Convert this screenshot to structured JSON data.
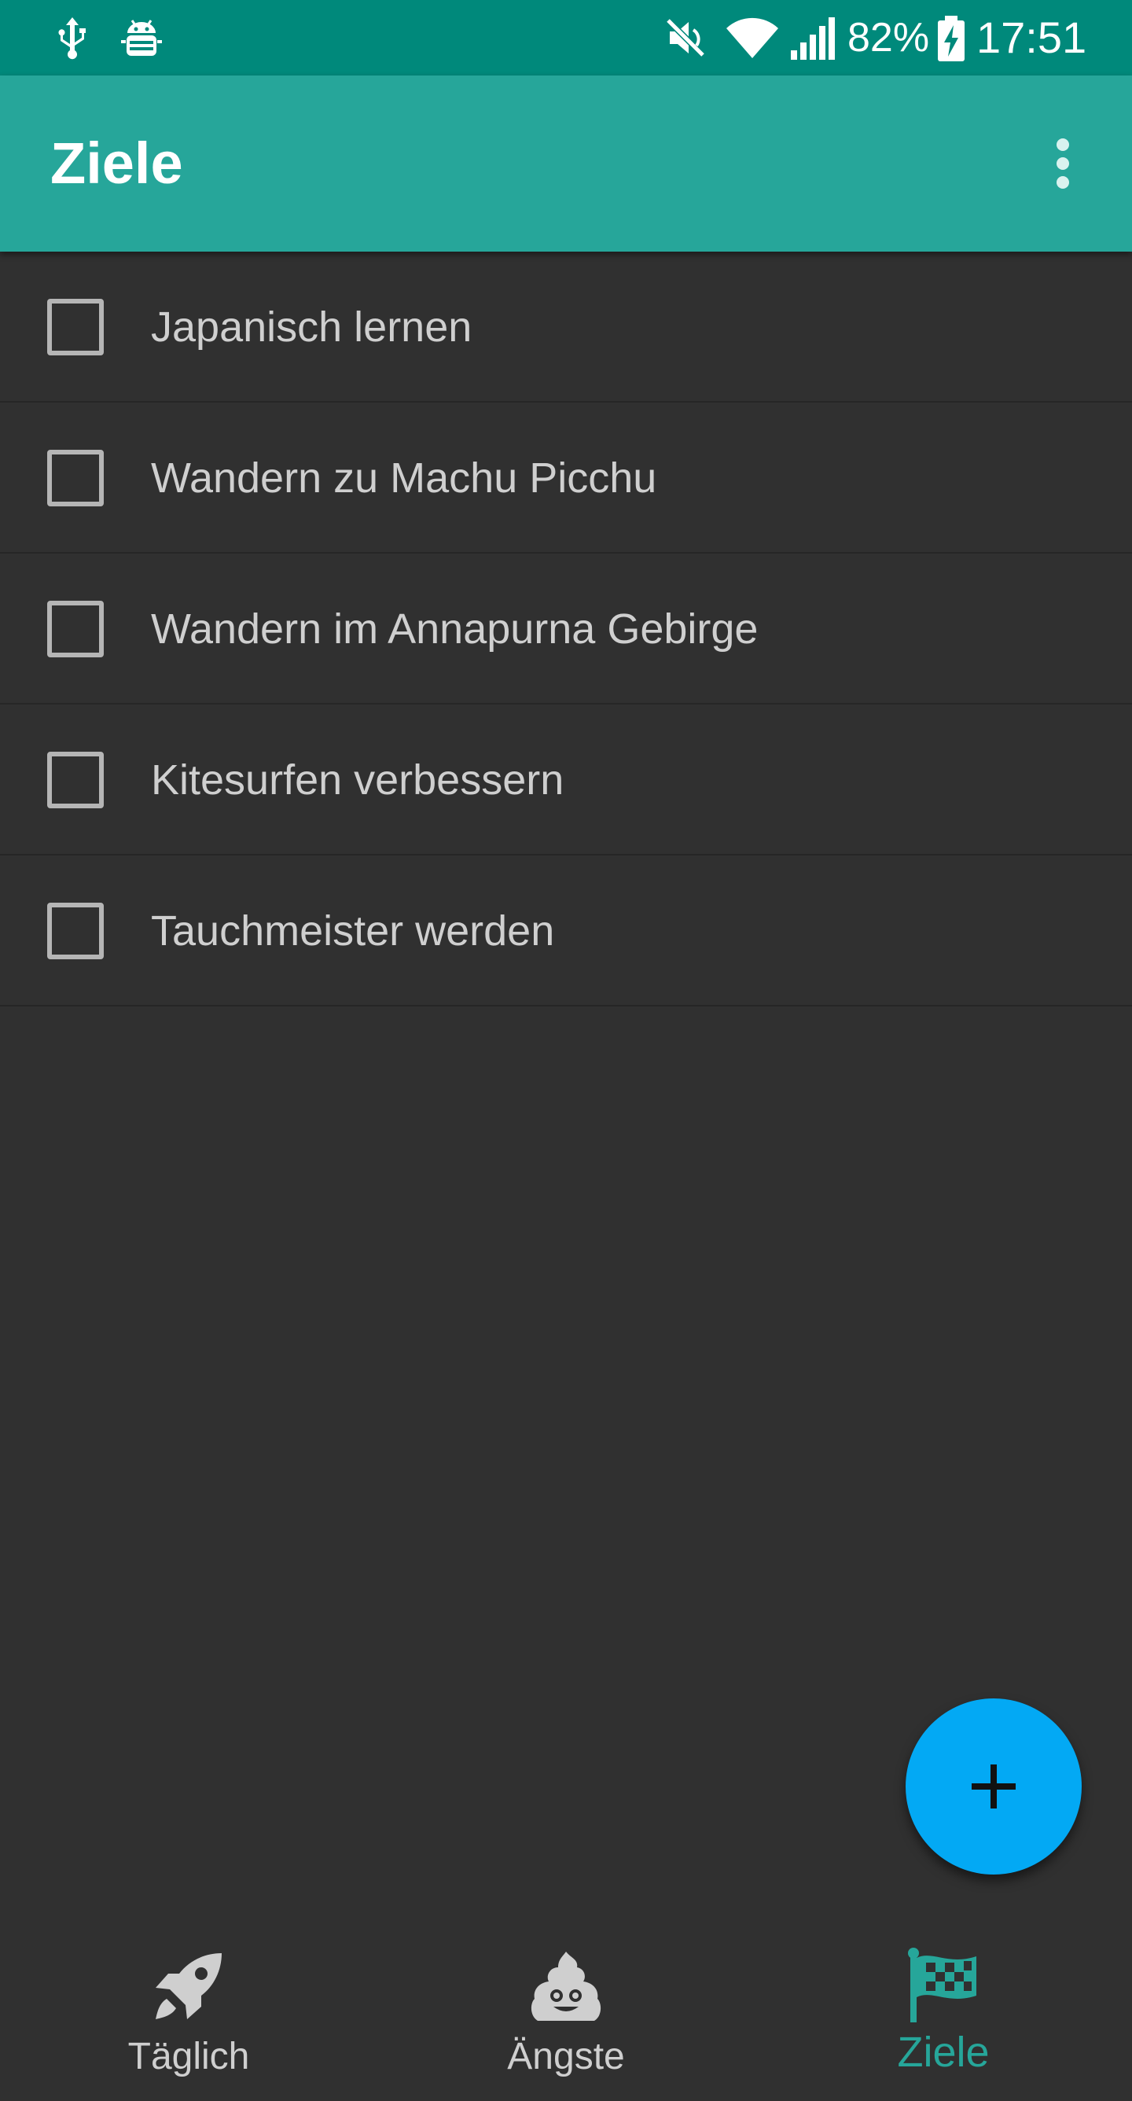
{
  "status_bar": {
    "battery_percent": "82%",
    "time": "17:51",
    "icons": [
      "usb-icon",
      "android-debug-icon",
      "mute-icon",
      "wifi-icon",
      "signal-icon",
      "battery-charging-icon"
    ]
  },
  "app_bar": {
    "title": "Ziele",
    "overflow_icon": "more-vert-icon"
  },
  "goals": [
    {
      "label": "Japanisch lernen",
      "checked": false
    },
    {
      "label": "Wandern zu Machu Picchu",
      "checked": false
    },
    {
      "label": "Wandern im Annapurna Gebirge",
      "checked": false
    },
    {
      "label": "Kitesurfen verbessern",
      "checked": false
    },
    {
      "label": "Tauchmeister werden",
      "checked": false
    }
  ],
  "fab": {
    "icon": "plus-icon"
  },
  "bottom_nav": {
    "items": [
      {
        "label": "Täglich",
        "icon": "rocket-icon",
        "active": false
      },
      {
        "label": "Ängste",
        "icon": "poop-icon",
        "active": false
      },
      {
        "label": "Ziele",
        "icon": "checkered-flag-icon",
        "active": true
      }
    ]
  },
  "colors": {
    "status_bar": "#00897B",
    "app_bar": "#26A69A",
    "background": "#303030",
    "fab": "#03A9F4",
    "active_nav": "#26A69A",
    "text": "#CFCFCF"
  }
}
